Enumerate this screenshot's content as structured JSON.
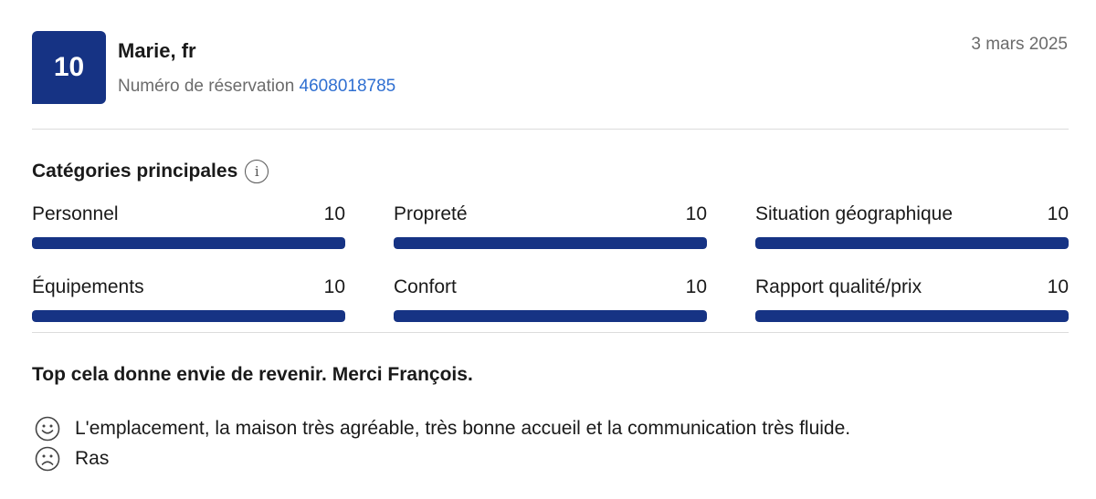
{
  "review": {
    "score": "10",
    "reviewer": "Marie, fr",
    "reservation_label": "Numéro de réservation",
    "reservation_number": "4608018785",
    "date": "3 mars 2025"
  },
  "categories": {
    "title": "Catégories principales",
    "info_icon": "info-icon",
    "items": [
      {
        "label": "Personnel",
        "score": "10",
        "fraction": 1.0
      },
      {
        "label": "Propreté",
        "score": "10",
        "fraction": 1.0
      },
      {
        "label": "Situation géographique",
        "score": "10",
        "fraction": 1.0
      },
      {
        "label": "Équipements",
        "score": "10",
        "fraction": 1.0
      },
      {
        "label": "Confort",
        "score": "10",
        "fraction": 1.0
      },
      {
        "label": "Rapport qualité/prix",
        "score": "10",
        "fraction": 1.0
      }
    ]
  },
  "comments": {
    "title": "Top cela donne envie de revenir. Merci François.",
    "positive": "L'emplacement, la maison très agréable, très bonne accueil et la communication très fluide.",
    "negative": "Ras",
    "positive_icon": "smiley-icon",
    "negative_icon": "frown-icon"
  },
  "colors": {
    "brand": "#163384",
    "link": "#2f6fd1"
  }
}
